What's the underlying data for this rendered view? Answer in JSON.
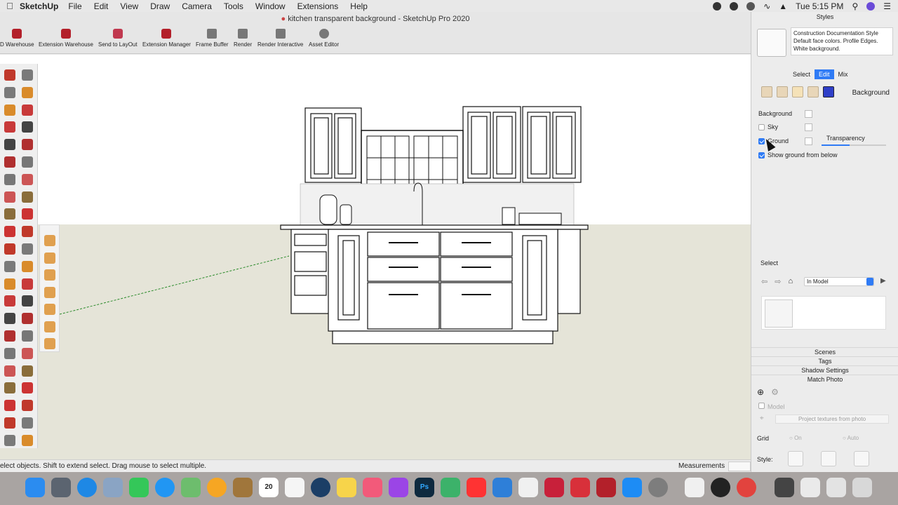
{
  "menubar": {
    "app": "SketchUp",
    "items": [
      "File",
      "Edit",
      "View",
      "Draw",
      "Camera",
      "Tools",
      "Window",
      "Extensions",
      "Help"
    ],
    "clock": "Tue 5:15 PM"
  },
  "window": {
    "title": "kitchen transparent background - SketchUp Pro 2020"
  },
  "toolbar": {
    "items": [
      {
        "label": "D Warehouse",
        "icon": "3d-warehouse-icon"
      },
      {
        "label": "Extension Warehouse",
        "icon": "extension-warehouse-icon"
      },
      {
        "label": "Send to LayOut",
        "icon": "layout-icon"
      },
      {
        "label": "Extension Manager",
        "icon": "extension-manager-icon"
      },
      {
        "label": "Frame Buffer",
        "icon": "frame-buffer-icon"
      },
      {
        "label": "Render",
        "icon": "render-icon"
      },
      {
        "label": "Render Interactive",
        "icon": "render-interactive-icon"
      },
      {
        "label": "Asset Editor",
        "icon": "asset-editor-icon"
      }
    ]
  },
  "status": {
    "message": "elect objects. Shift to extend select. Drag mouse to select multiple.",
    "measurements_label": "Measurements"
  },
  "tray": {
    "title": "Styles",
    "style_name": "Construction Documentation Style",
    "style_desc": "Default face colors. Profile Edges. White background.",
    "tabs": [
      "Select",
      "Edit",
      "Mix"
    ],
    "active_tab": "Edit",
    "section_label": "Background",
    "background_label": "Background",
    "sky_label": "Sky",
    "ground_label": "Ground",
    "transparency_label": "Transparency",
    "transparency_value": 0.43,
    "show_ground_label": "Show ground from below",
    "sky_checked": false,
    "ground_checked": true,
    "show_ground_checked": true,
    "select_label": "Select",
    "model_dropdown": "In Model",
    "panels": [
      "Scenes",
      "Tags",
      "Shadow Settings",
      "Match Photo"
    ],
    "match_photo": {
      "model_label": "Model",
      "project_button": "Project textures from photo",
      "grid_label": "Grid",
      "grid_on": "On",
      "grid_auto": "Auto",
      "style_label": "Style:"
    }
  },
  "dock": {
    "calendar_month": "OCT",
    "calendar_day": "20",
    "photoshop_label": "Ps"
  },
  "colors": {
    "accent": "#2f7bf5",
    "ground": "#e5e4d8",
    "sky": "#ffffff",
    "sketchup_red": "#b3202a"
  }
}
